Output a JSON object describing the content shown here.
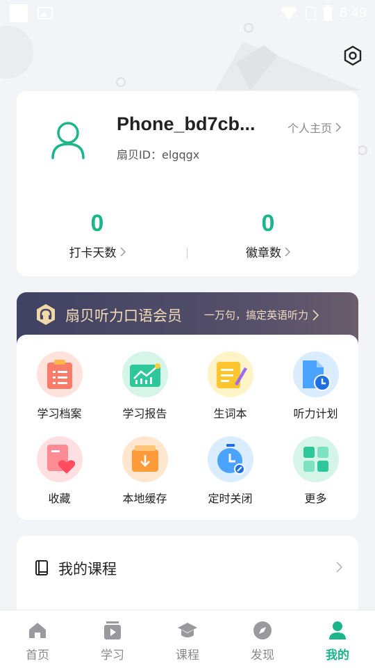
{
  "status_bar": {
    "time": "8:49"
  },
  "profile": {
    "username": "Phone_bd7cb...",
    "user_id": "扇贝ID：elgqgx",
    "homepage_link": "个人主页",
    "stats": [
      {
        "value": "0",
        "label": "打卡天数"
      },
      {
        "value": "0",
        "label": "徽章数"
      }
    ]
  },
  "vip": {
    "title": "扇贝听力口语会员",
    "subtitle": "一万句，搞定英语听力"
  },
  "tools": [
    {
      "label": "学习档案",
      "icon": "study-record-icon"
    },
    {
      "label": "学习报告",
      "icon": "study-report-icon"
    },
    {
      "label": "生词本",
      "icon": "vocabulary-book-icon"
    },
    {
      "label": "听力计划",
      "icon": "listening-plan-icon"
    },
    {
      "label": "收藏",
      "icon": "favorites-icon"
    },
    {
      "label": "本地缓存",
      "icon": "local-cache-icon"
    },
    {
      "label": "定时关闭",
      "icon": "timer-icon"
    },
    {
      "label": "更多",
      "icon": "more-grid-icon"
    }
  ],
  "courses": {
    "title": "我的课程"
  },
  "tabbar": {
    "items": [
      {
        "label": "首页",
        "icon": "home-icon"
      },
      {
        "label": "学习",
        "icon": "study-icon"
      },
      {
        "label": "课程",
        "icon": "course-icon"
      },
      {
        "label": "发现",
        "icon": "discover-icon"
      },
      {
        "label": "我的",
        "icon": "profile-icon"
      }
    ],
    "active_index": 4
  },
  "colors": {
    "accent": "#1cb58a",
    "vip_text": "#f3dcb6",
    "background": "#f3f4f7"
  }
}
